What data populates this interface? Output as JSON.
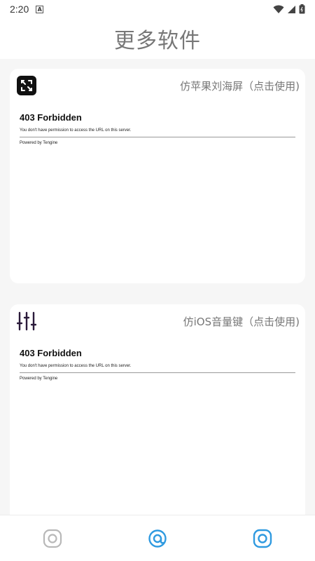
{
  "status_bar": {
    "time": "2:20",
    "notification_icon": "a-badge-icon",
    "right_icons": [
      "wifi-icon",
      "signal-icon",
      "battery-icon"
    ]
  },
  "header": {
    "title": "更多软件"
  },
  "cards": [
    {
      "icon": "fullscreen-expand-icon",
      "title": "仿苹果刘海屏（点击使用)",
      "webview": {
        "error_title": "403 Forbidden",
        "error_message": "You don't have permission to access the URL on this server.",
        "powered_by": "Powered by Tengine"
      }
    },
    {
      "icon": "equalizer-sliders-icon",
      "title": "仿iOS音量键（点击使用)",
      "webview": {
        "error_title": "403 Forbidden",
        "error_message": "You don't have permission to access the URL on this server.",
        "powered_by": "Powered by Tengine"
      }
    }
  ],
  "bottom_nav": {
    "items": [
      {
        "icon": "circle-target-icon",
        "active": false
      },
      {
        "icon": "at-circle-icon",
        "active": true
      },
      {
        "icon": "circle-target-icon",
        "active": true
      }
    ],
    "colors": {
      "active": "#2f9ae0",
      "inactive": "#b8b8b8"
    }
  }
}
